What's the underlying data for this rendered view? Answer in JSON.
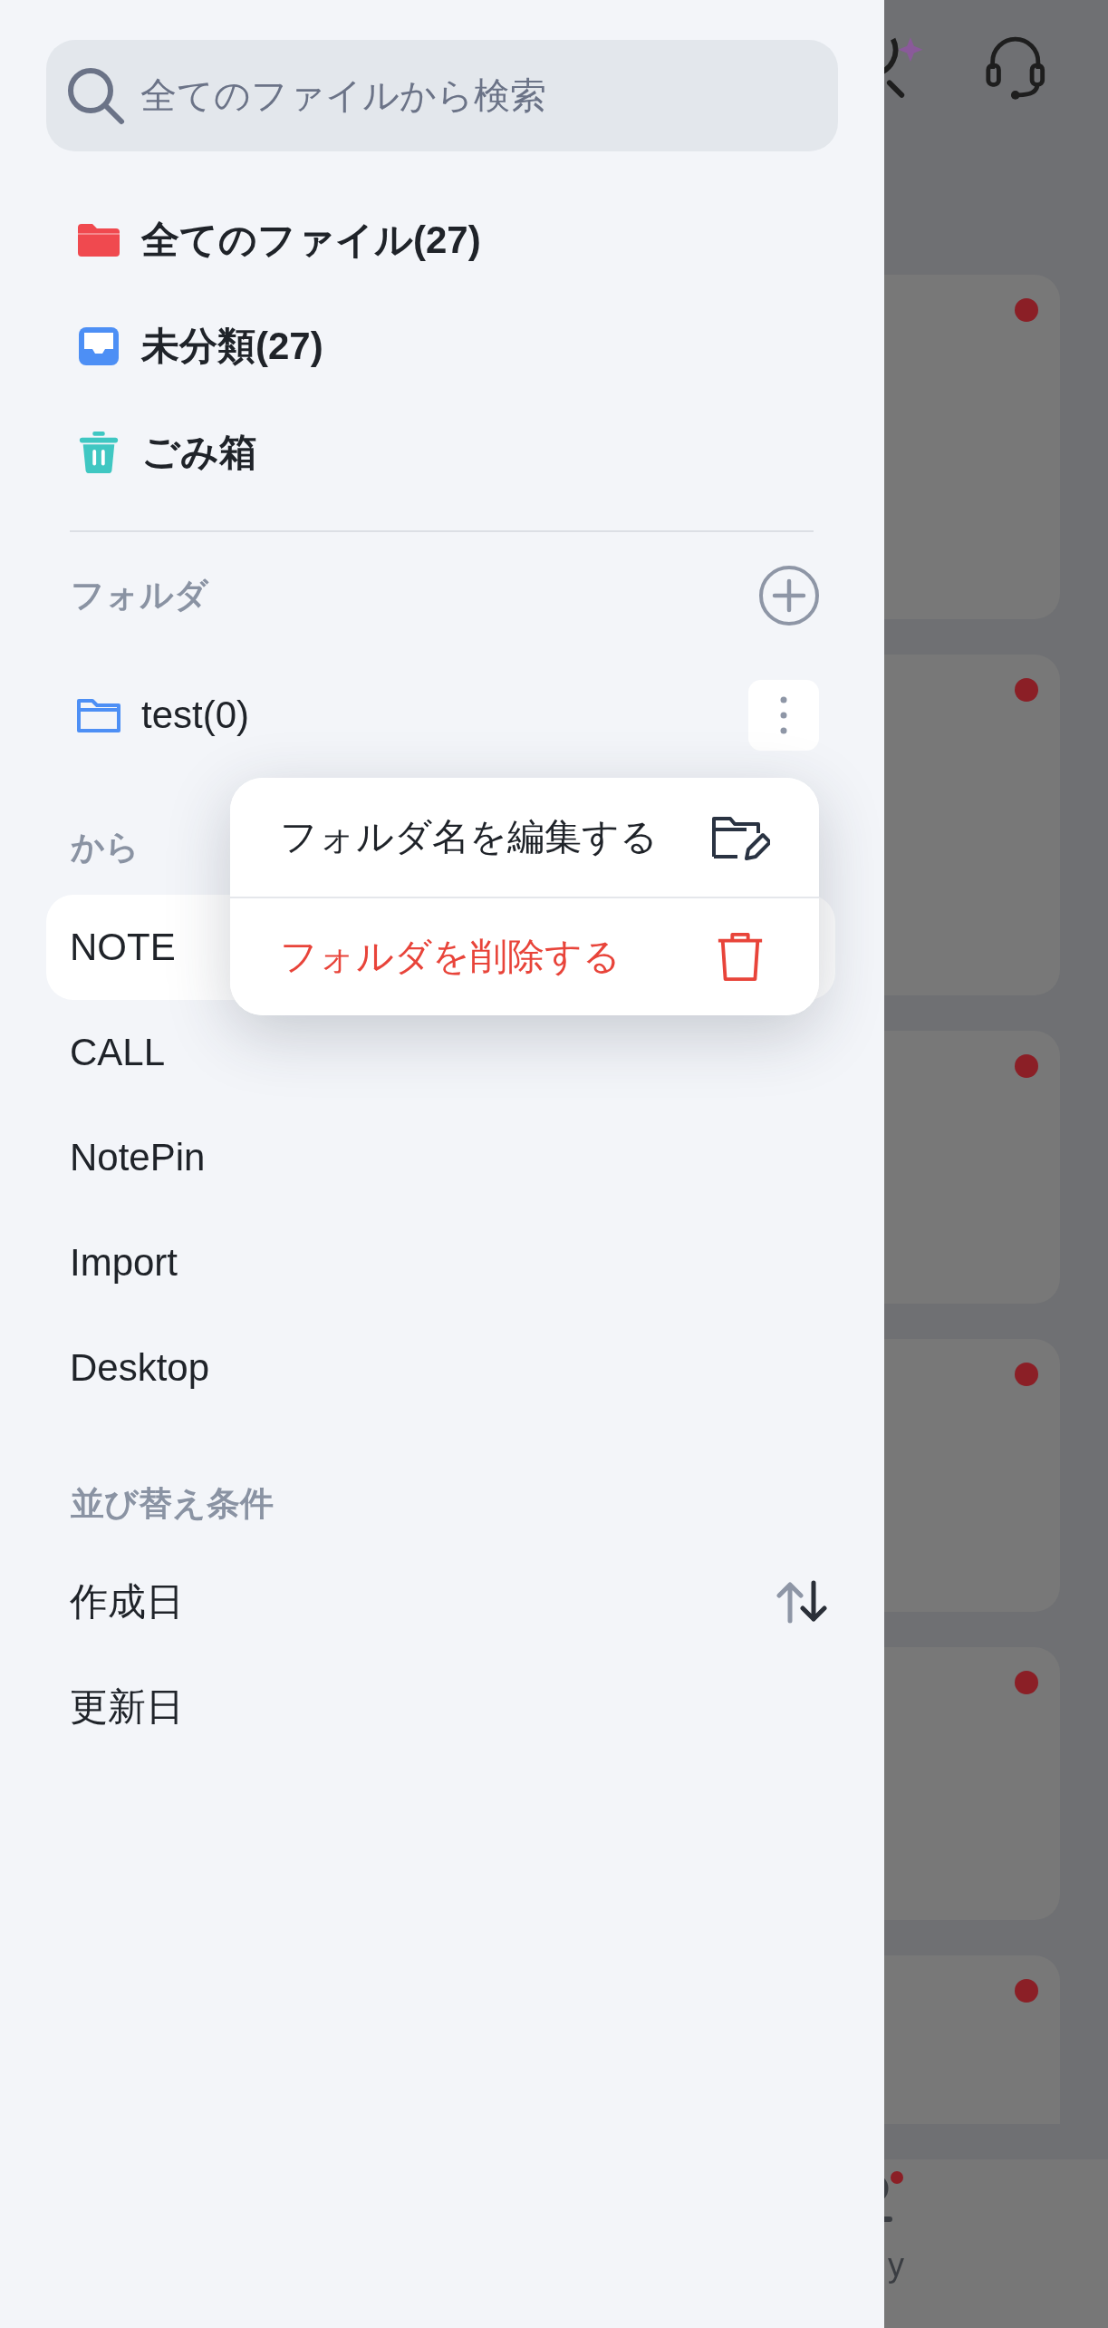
{
  "search": {
    "placeholder": "全てのファイルから検索"
  },
  "nav_items": [
    {
      "label": "全てのファイル(27)",
      "kind": "all"
    },
    {
      "label": "未分類(27)",
      "kind": "inbox"
    },
    {
      "label": "ごみ箱",
      "kind": "trash"
    }
  ],
  "folders": {
    "title": "フォルダ",
    "items": [
      {
        "label": "test(0)"
      }
    ]
  },
  "sources": {
    "title": "から",
    "items": [
      {
        "label": "NOTE",
        "selected": true
      },
      {
        "label": "CALL",
        "selected": false
      },
      {
        "label": "NotePin",
        "selected": false
      },
      {
        "label": "Import",
        "selected": false
      },
      {
        "label": "Desktop",
        "selected": false
      }
    ]
  },
  "sort": {
    "title": "並び替え条件",
    "items": [
      {
        "label": "作成日",
        "selected": true
      },
      {
        "label": "更新日",
        "selected": false
      }
    ]
  },
  "context_menu": [
    {
      "label": "フォルダ名を編集する",
      "kind": "rename"
    },
    {
      "label": "フォルダを削除する",
      "kind": "delete"
    }
  ],
  "background": {
    "cards": [
      {
        "unread": true
      },
      {
        "unread": true
      },
      {
        "unread": true
      },
      {
        "unread": true
      },
      {
        "unread": true
      },
      {
        "unread": true
      }
    ],
    "bottom_nav_label": "y"
  }
}
